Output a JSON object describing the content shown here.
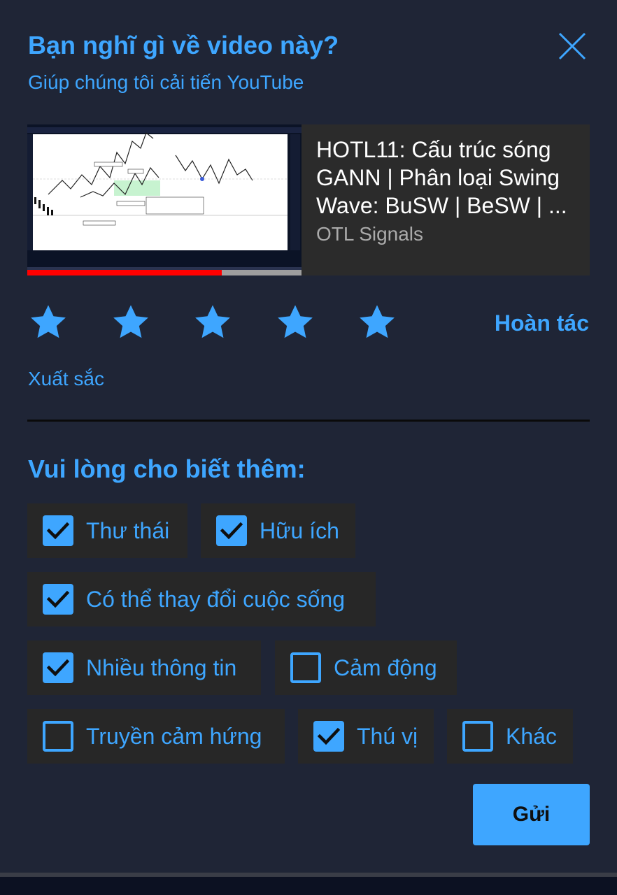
{
  "dialog": {
    "title": "Bạn nghĩ gì về video này?",
    "subtitle": "Giúp chúng tôi cải tiến YouTube",
    "close_icon": "close-icon"
  },
  "video": {
    "title": "HOTL11: Cấu trúc sóng GANN | Phân loại Swing Wave: BuSW | BeSW | ...",
    "channel": "OTL Signals",
    "watch_progress": 0.71
  },
  "rating": {
    "max": 5,
    "value": 5,
    "label": "Xuất sắc",
    "undo_label": "Hoàn tác",
    "star_icon": "star-icon"
  },
  "feedback": {
    "prompt": "Vui lòng cho biết thêm:",
    "options": [
      {
        "label": "Thư thái",
        "checked": true
      },
      {
        "label": "Hữu ích",
        "checked": true
      },
      {
        "label": "Có thể thay đổi cuộc sống",
        "checked": true
      },
      {
        "label": "Nhiều thông tin",
        "checked": true
      },
      {
        "label": "Cảm động",
        "checked": false
      },
      {
        "label": "Truyền cảm hứng",
        "checked": false
      },
      {
        "label": "Thú vị",
        "checked": true
      },
      {
        "label": "Khác",
        "checked": false
      }
    ]
  },
  "submit_label": "Gửi",
  "colors": {
    "accent": "#3ea6ff",
    "background": "#1f2536",
    "chip": "#272727",
    "progress": "#ff0000"
  }
}
